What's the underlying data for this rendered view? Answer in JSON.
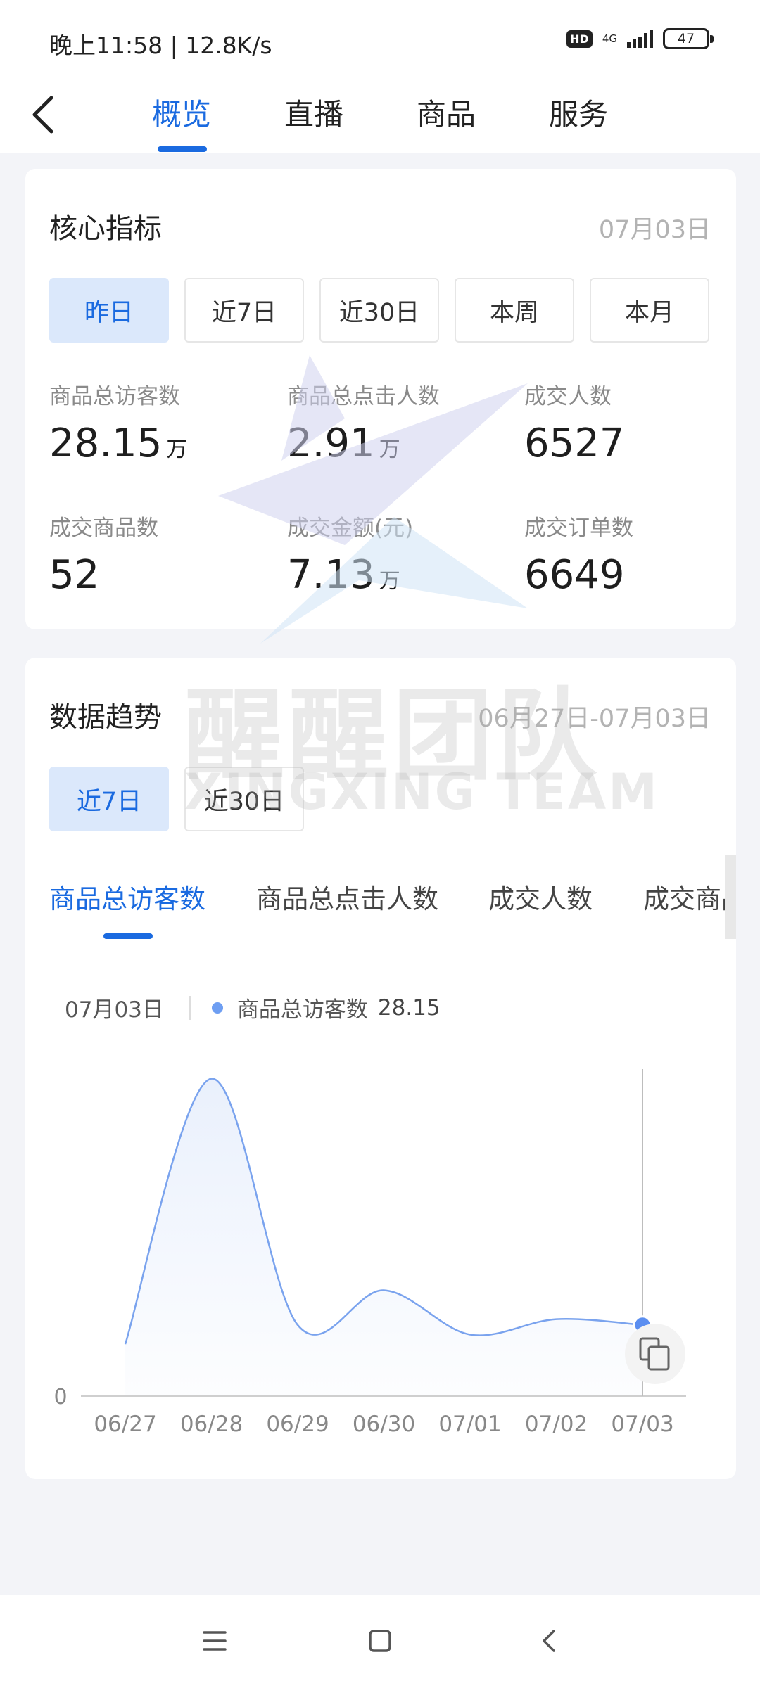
{
  "status_bar": {
    "time": "晚上11:58 | 12.8K/s",
    "hd": "HD",
    "network": "4G",
    "battery": "47"
  },
  "nav": {
    "back_icon": "chevron-left-icon",
    "tabs": [
      "概览",
      "直播",
      "商品",
      "服务"
    ],
    "active_tab": 0
  },
  "core_metrics": {
    "title": "核心指标",
    "date": "07月03日",
    "periods": [
      "昨日",
      "近7日",
      "近30日",
      "本周",
      "本月"
    ],
    "active_period": 0,
    "items": [
      {
        "label": "商品总访客数",
        "value": "28.15",
        "unit": "万"
      },
      {
        "label": "商品总点击人数",
        "value": "2.91",
        "unit": "万"
      },
      {
        "label": "成交人数",
        "value": "6527",
        "unit": ""
      },
      {
        "label": "成交商品数",
        "value": "52",
        "unit": ""
      },
      {
        "label": "成交金额(元)",
        "value": "7.13",
        "unit": "万"
      },
      {
        "label": "成交订单数",
        "value": "6649",
        "unit": ""
      }
    ]
  },
  "watermark": {
    "cn": "醒醒团队",
    "en": "XINGXING TEAM"
  },
  "trend": {
    "title": "数据趋势",
    "date_range": "06月27日-07月03日",
    "ranges": [
      "近7日",
      "近30日"
    ],
    "active_range": 0,
    "metric_tabs": [
      "商品总访客数",
      "商品总点击人数",
      "成交人数",
      "成交商品"
    ],
    "active_metric": 0,
    "tooltip": {
      "date": "07月03日",
      "series": "商品总访客数",
      "value": "28.15"
    },
    "copy_icon": "copy-icon"
  },
  "chart_data": {
    "type": "area",
    "x": [
      "06/27",
      "06/28",
      "06/29",
      "06/30",
      "07/01",
      "07/02",
      "07/03"
    ],
    "series": [
      {
        "name": "商品总访客数",
        "values": [
          27,
          165,
          37,
          55,
          32,
          40,
          37
        ]
      }
    ],
    "y_tick_labels": [
      "0"
    ],
    "ylim": [
      0,
      170
    ],
    "highlight_index": 6,
    "color": "#7aa3ee"
  },
  "system_nav": {
    "icons": [
      "menu-icon",
      "home-square-icon",
      "back-icon"
    ]
  }
}
